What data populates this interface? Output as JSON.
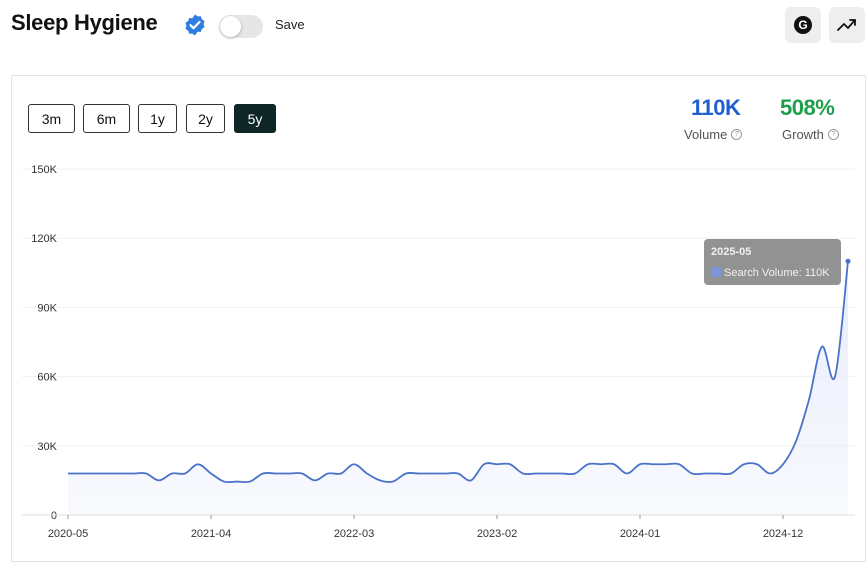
{
  "header": {
    "title": "Sleep Hygiene",
    "save_label": "Save",
    "g_button_label": "G"
  },
  "ranges": [
    "3m",
    "6m",
    "1y",
    "2y",
    "5y"
  ],
  "active_range": "5y",
  "metrics": {
    "volume": {
      "value": "110K",
      "label": "Volume",
      "color": "#1f5fd1"
    },
    "growth": {
      "value": "508%",
      "label": "Growth",
      "color": "#1e9e4a"
    }
  },
  "tooltip": {
    "date": "2025-05",
    "text": "Search Volume: 110K"
  },
  "colors": {
    "line": "#4a72c9",
    "area": "#e8edfa",
    "tooltip_bg": "#8c8c8c",
    "grid": "#f0f0f0",
    "verified": "#2f7de1"
  },
  "chart_data": {
    "type": "area",
    "series": [
      {
        "name": "Search Volume"
      }
    ],
    "yticks": [
      "0",
      "30K",
      "60K",
      "90K",
      "120K",
      "150K"
    ],
    "ylim": [
      0,
      150000
    ],
    "xticks": [
      "2020-05",
      "2021-04",
      "2022-03",
      "2023-02",
      "2024-01",
      "2024-12"
    ],
    "x": [
      "2020-05",
      "2020-06",
      "2020-07",
      "2020-08",
      "2020-09",
      "2020-10",
      "2020-11",
      "2020-12",
      "2021-01",
      "2021-02",
      "2021-03",
      "2021-04",
      "2021-05",
      "2021-06",
      "2021-07",
      "2021-08",
      "2021-09",
      "2021-10",
      "2021-11",
      "2021-12",
      "2022-01",
      "2022-02",
      "2022-03",
      "2022-04",
      "2022-05",
      "2022-06",
      "2022-07",
      "2022-08",
      "2022-09",
      "2022-10",
      "2022-11",
      "2022-12",
      "2023-01",
      "2023-02",
      "2023-03",
      "2023-04",
      "2023-05",
      "2023-06",
      "2023-07",
      "2023-08",
      "2023-09",
      "2023-10",
      "2023-11",
      "2023-12",
      "2024-01",
      "2024-02",
      "2024-03",
      "2024-04",
      "2024-05",
      "2024-06",
      "2024-07",
      "2024-08",
      "2024-09",
      "2024-10",
      "2024-11",
      "2024-12",
      "2025-01",
      "2025-02",
      "2025-03",
      "2025-04",
      "2025-05"
    ],
    "values": [
      18000,
      18000,
      18000,
      18000,
      18000,
      18000,
      18000,
      15000,
      18000,
      18000,
      22000,
      18000,
      14500,
      14500,
      14500,
      18000,
      18000,
      18000,
      18000,
      15000,
      18000,
      18000,
      22000,
      18000,
      15000,
      14500,
      18000,
      18000,
      18000,
      18000,
      18000,
      15000,
      22000,
      22000,
      22000,
      18000,
      18000,
      18000,
      18000,
      18000,
      22000,
      22000,
      22000,
      18000,
      22000,
      22000,
      22000,
      22000,
      18000,
      18000,
      18000,
      18000,
      22000,
      22000,
      18000,
      22000,
      32000,
      50000,
      73000,
      60000,
      110000
    ]
  }
}
